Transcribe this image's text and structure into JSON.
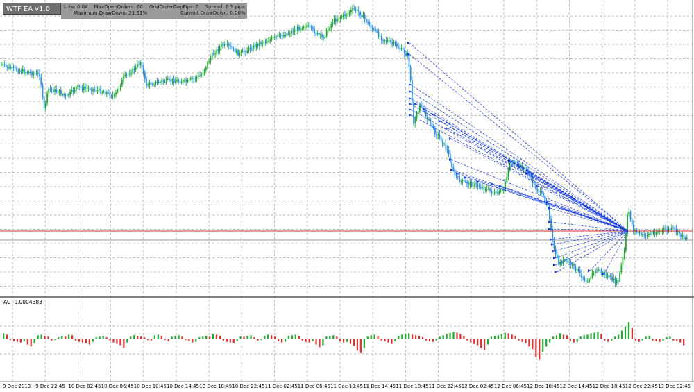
{
  "ea_panel": {
    "title": "WTF EA v1.0",
    "lots": "Lots: 0.04",
    "max_open_orders": "MaxOpenOrders: 60",
    "grid_gap": "GridOrderGapPips: 5",
    "spread": "Spread: 6.3 pips",
    "max_drawdown": "Maximum DrawDown: 21.51%",
    "current_drawdown": "Current DrawDown: 0.00%"
  },
  "indicator": {
    "label": "AC -0.0004383"
  },
  "colors": {
    "bull": "#22aa33",
    "bear": "#2d8fe0",
    "ac_up": "#22aa33",
    "ac_down": "#e03030",
    "order_line": "#1a3fe0",
    "price_line_red": "#e03030",
    "grid": "#b8b8b8"
  },
  "chart_data": {
    "type": "candlestick",
    "xlabel": "",
    "ylabel": "",
    "grid": true,
    "x_ticks": [
      "9 Dec 2013",
      "9 Dec 22:45",
      "10 Dec 02:45",
      "10 Dec 06:45",
      "10 Dec 10:45",
      "10 Dec 14:45",
      "10 Dec 18:45",
      "10 Dec 22:45",
      "11 Dec 02:45",
      "11 Dec 06:45",
      "11 Dec 10:45",
      "11 Dec 14:45",
      "11 Dec 18:45",
      "11 Dec 22:45",
      "12 Dec 02:45",
      "12 Dec 06:45",
      "12 Dec 10:45",
      "12 Dec 14:45",
      "12 Dec 18:45",
      "12 Dec 22:45",
      "13 Dec 02:45"
    ],
    "price_path": [
      [
        0,
        92
      ],
      [
        10,
        97
      ],
      [
        22,
        100
      ],
      [
        40,
        104
      ],
      [
        58,
        108
      ],
      [
        63,
        160
      ],
      [
        70,
        128
      ],
      [
        85,
        132
      ],
      [
        95,
        140
      ],
      [
        110,
        126
      ],
      [
        130,
        128
      ],
      [
        150,
        132
      ],
      [
        165,
        139
      ],
      [
        178,
        112
      ],
      [
        195,
        98
      ],
      [
        203,
        88
      ],
      [
        210,
        122
      ],
      [
        230,
        118
      ],
      [
        250,
        116
      ],
      [
        270,
        118
      ],
      [
        290,
        108
      ],
      [
        305,
        80
      ],
      [
        320,
        65
      ],
      [
        330,
        67
      ],
      [
        345,
        78
      ],
      [
        360,
        70
      ],
      [
        375,
        62
      ],
      [
        395,
        55
      ],
      [
        415,
        48
      ],
      [
        440,
        36
      ],
      [
        465,
        55
      ],
      [
        480,
        30
      ],
      [
        500,
        20
      ],
      [
        510,
        13
      ],
      [
        520,
        20
      ],
      [
        535,
        40
      ],
      [
        550,
        55
      ],
      [
        570,
        65
      ],
      [
        588,
        80
      ],
      [
        592,
        120
      ],
      [
        596,
        180
      ],
      [
        605,
        150
      ],
      [
        615,
        168
      ],
      [
        625,
        188
      ],
      [
        635,
        200
      ],
      [
        645,
        218
      ],
      [
        655,
        252
      ],
      [
        665,
        262
      ],
      [
        680,
        265
      ],
      [
        700,
        272
      ],
      [
        715,
        280
      ],
      [
        725,
        275
      ],
      [
        735,
        232
      ],
      [
        750,
        240
      ],
      [
        760,
        246
      ],
      [
        770,
        268
      ],
      [
        780,
        280
      ],
      [
        790,
        295
      ],
      [
        793,
        325
      ],
      [
        798,
        360
      ],
      [
        805,
        380
      ],
      [
        815,
        375
      ],
      [
        830,
        388
      ],
      [
        845,
        405
      ],
      [
        860,
        388
      ],
      [
        875,
        398
      ],
      [
        890,
        408
      ],
      [
        900,
        360
      ],
      [
        905,
        300
      ],
      [
        912,
        330
      ],
      [
        925,
        340
      ],
      [
        940,
        336
      ],
      [
        955,
        332
      ],
      [
        970,
        330
      ],
      [
        985,
        342
      ]
    ],
    "ac_values": [
      0.8,
      0.6,
      -0.2,
      -0.4,
      -0.5,
      -0.6,
      -0.4,
      -0.9,
      -1.2,
      -0.7,
      0.5,
      0.6,
      0.4,
      0.3,
      -0.3,
      -0.2,
      0.2,
      0.4,
      0.3,
      0.6,
      0.5,
      -0.3,
      -0.5,
      -0.6,
      -0.7,
      -0.9,
      -0.5,
      0.2,
      0.3,
      0.4,
      0.2,
      -0.3,
      -0.6,
      -0.8,
      -1.0,
      -1.4,
      -0.6,
      0.3,
      0.5,
      0.4,
      0.3,
      0.2,
      -0.2,
      -0.3,
      0.5,
      0.6,
      0.4,
      -0.2,
      -0.4,
      0.3,
      0.4,
      0.5,
      0.3,
      -0.2,
      -0.4,
      -0.6,
      -0.5,
      0.2,
      0.3,
      0.4,
      0.3,
      0.7,
      0.6,
      0.4,
      -0.3,
      -0.5,
      -0.6,
      -0.7,
      -0.4,
      0.3,
      0.3,
      0.4,
      0.5,
      0.2,
      -0.3,
      -0.2,
      0.4,
      0.6,
      0.5,
      0.3,
      -0.4,
      -0.6,
      -0.5,
      0.4,
      0.5,
      0.6,
      0.4,
      -0.3,
      -0.5,
      -0.6,
      -0.4,
      -0.9,
      -1.3,
      -1.0,
      0.3,
      0.4,
      0.5,
      0.3,
      -0.4,
      -0.6,
      -0.5,
      -0.8,
      -1.1,
      -1.8,
      -2.2,
      -1.4,
      0.3,
      0.5,
      0.6,
      0.4,
      -0.3,
      -0.4,
      -0.6,
      -0.8,
      -0.4,
      0.4,
      0.6,
      0.7,
      0.8,
      0.6,
      0.5,
      0.4,
      0.2,
      -0.3,
      -0.4,
      -0.5,
      -0.3,
      0.3,
      0.5,
      0.7,
      0.9,
      1.0,
      0.9,
      0.7,
      0.4,
      -0.3,
      -0.6,
      -0.8,
      -1.0,
      -1.4,
      -1.7,
      -0.9,
      0.3,
      0.4,
      0.5,
      0.7,
      0.9,
      0.8,
      0.6,
      0.4,
      -0.3,
      -0.5,
      -0.7,
      -1.2,
      -1.6,
      -2.8,
      -3.2,
      -2.0,
      -1.2,
      -0.6,
      0.3,
      0.5,
      0.8,
      0.6,
      0.5,
      -0.4,
      -0.6,
      -0.5,
      0.3,
      0.5,
      0.6,
      0.8,
      0.9,
      1.0,
      0.7,
      -0.3,
      -0.5,
      -0.3,
      0.3,
      0.6,
      1.2,
      1.8,
      2.5,
      1.6,
      -0.3,
      -0.5,
      -0.3,
      0.3,
      0.4,
      -0.3,
      -0.4,
      -0.5,
      -0.3,
      0.2,
      0.3,
      -0.3,
      -0.4,
      -0.6,
      -1.0
    ]
  }
}
